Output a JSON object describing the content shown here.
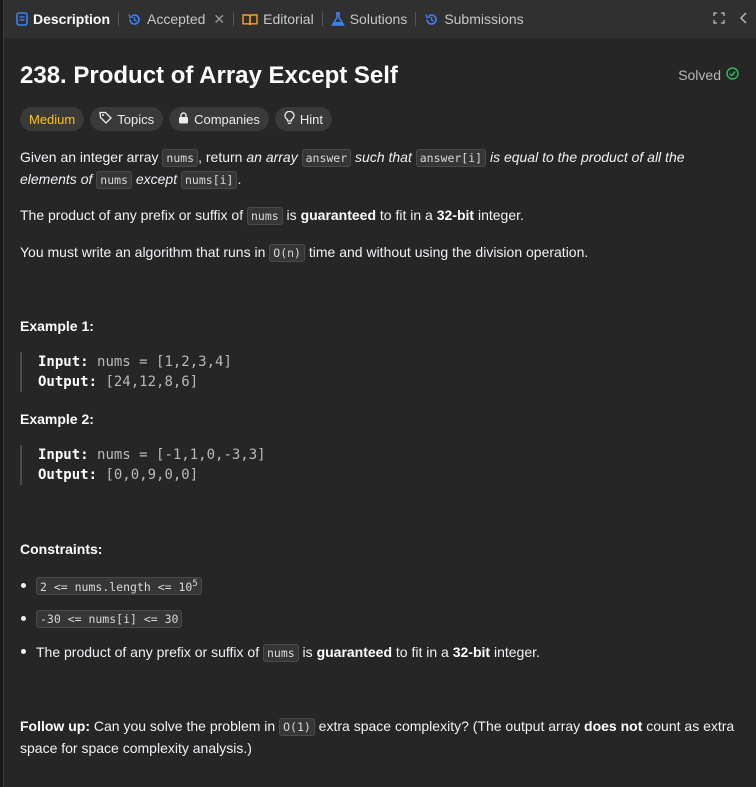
{
  "tabs": [
    {
      "label": "Description"
    },
    {
      "label": "Accepted"
    },
    {
      "label": "Editorial"
    },
    {
      "label": "Solutions"
    },
    {
      "label": "Submissions"
    }
  ],
  "problem": {
    "title": "238. Product of Array Except Self",
    "solved_label": "Solved",
    "tags": {
      "difficulty": "Medium",
      "topics": "Topics",
      "companies": "Companies",
      "hint": "Hint"
    }
  },
  "description": {
    "p1": {
      "t1": "Given an integer array ",
      "c1": "nums",
      "t2": ", return ",
      "e1": "an array",
      "t3": " ",
      "c2": "answer",
      "e2": " such that ",
      "c3": "answer[i]",
      "e3": " is equal to the product of all the elements of ",
      "c4": "nums",
      "e4": " except ",
      "c5": "nums[i]",
      "t4": "."
    },
    "p2": {
      "t1": "The product of any prefix or suffix of ",
      "c1": "nums",
      "t2": " is ",
      "b1": "guaranteed",
      "t3": " to fit in a ",
      "b2": "32-bit",
      "t4": " integer."
    },
    "p3": {
      "t1": "You must write an algorithm that runs in ",
      "c1": "O(n)",
      "t2": " time and without using the division operation."
    }
  },
  "examples": [
    {
      "heading": "Example 1:",
      "input_label": "Input:",
      "input": "nums = [1,2,3,4]",
      "output_label": "Output:",
      "output": "[24,12,8,6]"
    },
    {
      "heading": "Example 2:",
      "input_label": "Input:",
      "input": "nums = [-1,1,0,-3,3]",
      "output_label": "Output:",
      "output": "[0,0,9,0,0]"
    }
  ],
  "constraints": {
    "heading": "Constraints:",
    "c1": {
      "code": "2 <= nums.length <= 10",
      "sup": "5"
    },
    "c2": {
      "code": "-30 <= nums[i] <= 30"
    },
    "c3": {
      "t1": "The product of any prefix or suffix of ",
      "c1": "nums",
      "t2": " is ",
      "b1": "guaranteed",
      "t3": " to fit in a ",
      "b2": "32-bit",
      "t4": " integer."
    }
  },
  "followup": {
    "label": "Follow up:",
    "t1": " Can you solve the problem in ",
    "c1": "O(1)",
    "t2": " extra space complexity? (The output array ",
    "b1": "does not",
    "t3": " count as extra space for space complexity analysis.)"
  },
  "colors": {
    "medium": "#ffc01e",
    "solved_check": "#2cbb5d",
    "accent_blue": "#3b82f6"
  }
}
